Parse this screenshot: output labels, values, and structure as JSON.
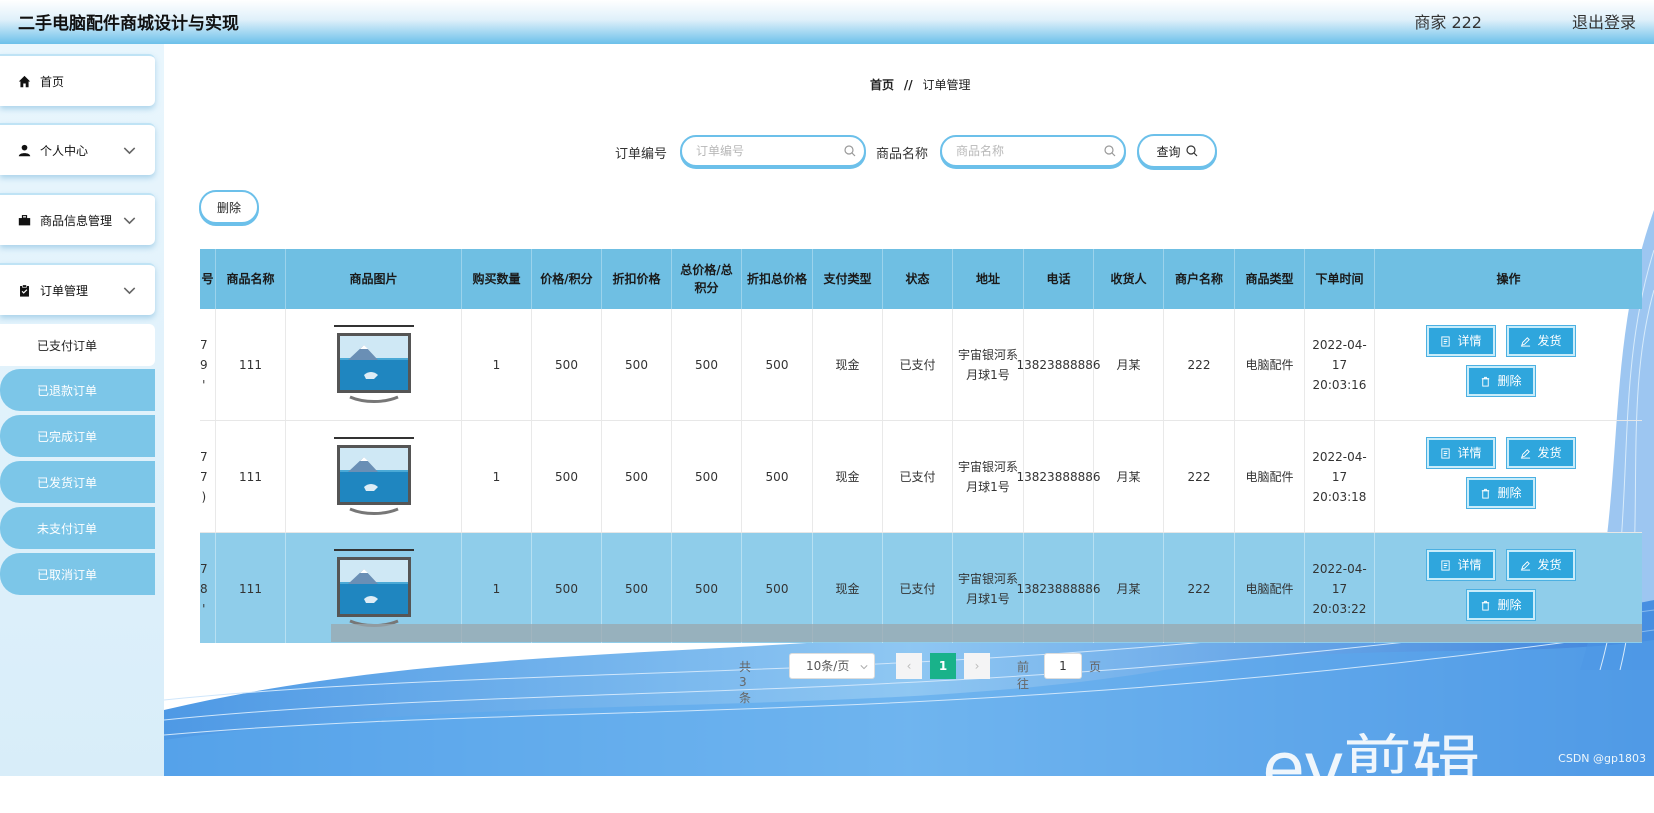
{
  "header": {
    "title": "二手电脑配件商城设计与实现",
    "user": "商家 222",
    "logout": "退出登录"
  },
  "sidebar": {
    "items": [
      {
        "label": "首页",
        "icon": "home-icon"
      },
      {
        "label": "个人中心",
        "icon": "user-icon"
      },
      {
        "label": "商品信息管理",
        "icon": "briefcase-icon"
      },
      {
        "label": "订单管理",
        "icon": "clipboard-icon"
      }
    ],
    "sub_items": [
      "已支付订单",
      "已退款订单",
      "已完成订单",
      "已发货订单",
      "未支付订单",
      "已取消订单"
    ]
  },
  "breadcrumb": {
    "home": "首页",
    "sep": "//",
    "current": "订单管理"
  },
  "search": {
    "order_no_label": "订单编号",
    "order_no_placeholder": "订单编号",
    "product_label": "商品名称",
    "product_placeholder": "商品名称",
    "query_button": "查询"
  },
  "toolbar": {
    "delete_button": "删除"
  },
  "table": {
    "headers": [
      "号",
      "商品名称",
      "商品图片",
      "购买数量",
      "价格/积分",
      "折扣价格",
      "总价格/总积分",
      "折扣总价格",
      "支付类型",
      "状态",
      "地址",
      "电话",
      "收货人",
      "商户名称",
      "商品类型",
      "下单时间",
      "操作"
    ],
    "rows": [
      {
        "id_fragment": "7\n9\n'",
        "name": "111",
        "qty": "1",
        "price": "500",
        "discount": "500",
        "total": "500",
        "discount_total": "500",
        "pay_type": "现金",
        "status": "已支付",
        "address": "宇宙银河系月球1号",
        "phone": "13823888886",
        "receiver": "月某",
        "merchant": "222",
        "category": "电脑配件",
        "time": "2022-04-17 20:03:16"
      },
      {
        "id_fragment": "7\n7\n)",
        "name": "111",
        "qty": "1",
        "price": "500",
        "discount": "500",
        "total": "500",
        "discount_total": "500",
        "pay_type": "现金",
        "status": "已支付",
        "address": "宇宙银河系月球1号",
        "phone": "13823888886",
        "receiver": "月某",
        "merchant": "222",
        "category": "电脑配件",
        "time": "2022-04-17 20:03:18"
      },
      {
        "id_fragment": "7\n8\n'",
        "name": "111",
        "qty": "1",
        "price": "500",
        "discount": "500",
        "total": "500",
        "discount_total": "500",
        "pay_type": "现金",
        "status": "已支付",
        "address": "宇宙银河系月球1号",
        "phone": "13823888886",
        "receiver": "月某",
        "merchant": "222",
        "category": "电脑配件",
        "time": "2022-04-17 20:03:22"
      }
    ],
    "actions": {
      "detail": "详情",
      "ship": "发货",
      "delete": "删除"
    }
  },
  "pagination": {
    "total": "共 3 条",
    "page_size": "10条/页",
    "current_page": "1",
    "goto_prefix": "前往",
    "goto_value": "1",
    "goto_suffix": "页",
    "prev": "‹",
    "next": "›"
  },
  "watermark": {
    "logo": "ev剪辑",
    "credit": "CSDN @gp1803"
  },
  "colors": {
    "accent": "#6fbfe3",
    "button": "#2fa6dd",
    "page_active": "#19b28a",
    "row_highlight": "#8fcdea"
  }
}
